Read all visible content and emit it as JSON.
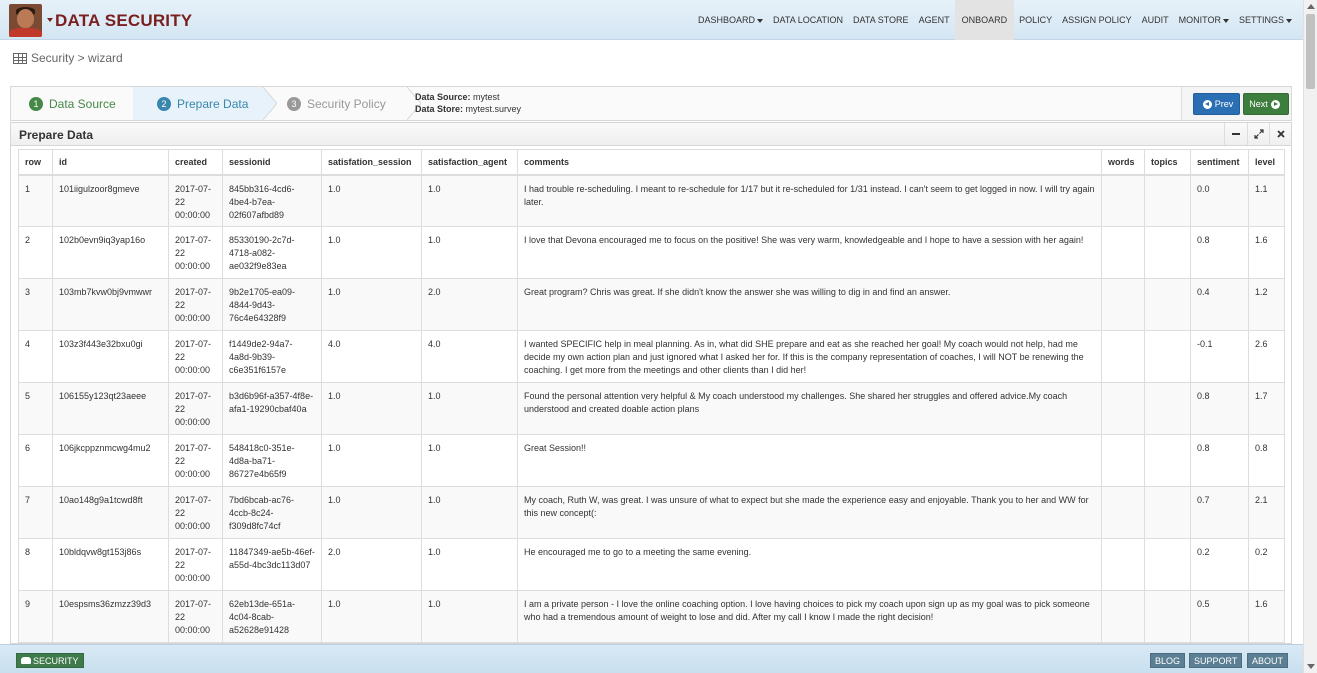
{
  "brand": {
    "title": "DATA SECURITY"
  },
  "nav": {
    "items": [
      {
        "label": "DASHBOARD",
        "dropdown": true
      },
      {
        "label": "DATA LOCATION",
        "dropdown": false
      },
      {
        "label": "DATA STORE",
        "dropdown": false
      },
      {
        "label": "AGENT",
        "dropdown": false
      },
      {
        "label": "ONBOARD",
        "dropdown": false,
        "active": true
      },
      {
        "label": "POLICY",
        "dropdown": false
      },
      {
        "label": "ASSIGN POLICY",
        "dropdown": false
      },
      {
        "label": "AUDIT",
        "dropdown": false
      },
      {
        "label": "MONITOR",
        "dropdown": true
      },
      {
        "label": "SETTINGS",
        "dropdown": true
      }
    ]
  },
  "breadcrumb": {
    "text": "Security > wizard"
  },
  "wizard": {
    "steps": [
      {
        "num": "1",
        "label": "Data Source"
      },
      {
        "num": "2",
        "label": "Prepare Data"
      },
      {
        "num": "3",
        "label": "Security Policy"
      }
    ],
    "source_label": "Data Source:",
    "source_value": "mytest",
    "store_label": "Data Store:",
    "store_value": "mytest.survey",
    "prev_label": "Prev",
    "next_label": "Next"
  },
  "panel": {
    "title": "Prepare Data"
  },
  "table": {
    "columns": [
      "row",
      "id",
      "created",
      "sessionid",
      "satisfation_session",
      "satisfaction_agent",
      "comments",
      "words",
      "topics",
      "sentiment",
      "level"
    ],
    "rows": [
      [
        "1",
        "101iigulzoor8gmeve",
        "2017-07-22 00:00:00",
        "845bb316-4cd6-4be4-b7ea-02f607afbd89",
        "1.0",
        "1.0",
        "I had trouble re-scheduling. I meant to re-schedule for 1/17 but it re-scheduled for 1/31 instead. I can't seem to get logged in now. I will try again later.",
        "",
        "",
        "0.0",
        "1.1"
      ],
      [
        "2",
        "102b0evn9iq3yap16o",
        "2017-07-22 00:00:00",
        "85330190-2c7d-4718-a082-ae032f9e83ea",
        "1.0",
        "1.0",
        "I love that Devona encouraged me to focus on the positive! She was very warm, knowledgeable and I hope to have a session with her again!",
        "",
        "",
        "0.8",
        "1.6"
      ],
      [
        "3",
        "103mb7kvw0bj9vmwwr",
        "2017-07-22 00:00:00",
        "9b2e1705-ea09-4844-9d43-76c4e64328f9",
        "1.0",
        "2.0",
        "Great program? Chris was great. If she didn't know the answer she was willing to dig in and find an answer.",
        "",
        "",
        "0.4",
        "1.2"
      ],
      [
        "4",
        "103z3f443e32bxu0gi",
        "2017-07-22 00:00:00",
        "f1449de2-94a7-4a8d-9b39-c6e351f6157e",
        "4.0",
        "4.0",
        "I wanted SPECIFIC help in meal planning. As in, what did SHE prepare and eat as she reached her goal! My coach would not help, had me decide my own action plan and just ignored what I asked her for. If this is the company representation of coaches, I will NOT be renewing the coaching. I get more from the meetings and other clients than I did her!",
        "",
        "",
        "-0.1",
        "2.6"
      ],
      [
        "5",
        "106155y123qt23aeee",
        "2017-07-22 00:00:00",
        "b3d6b96f-a357-4f8e-afa1-19290cbaf40a",
        "1.0",
        "1.0",
        "Found the personal attention very helpful & My coach understood my challenges. She shared her struggles and offered advice.My coach understood and created doable action plans",
        "",
        "",
        "0.8",
        "1.7"
      ],
      [
        "6",
        "106jkcppznmcwg4mu2",
        "2017-07-22 00:00:00",
        "548418c0-351e-4d8a-ba71-86727e4b65f9",
        "1.0",
        "1.0",
        "Great Session!!",
        "",
        "",
        "0.8",
        "0.8"
      ],
      [
        "7",
        "10ao148g9a1tcwd8ft",
        "2017-07-22 00:00:00",
        "7bd6bcab-ac76-4ccb-8c24-f309d8fc74cf",
        "1.0",
        "1.0",
        "My coach, Ruth W, was great. I was unsure of what to expect but she made the experience easy and enjoyable. Thank you to her and WW for this new concept(:",
        "",
        "",
        "0.7",
        "2.1"
      ],
      [
        "8",
        "10bldqvw8gt153j86s",
        "2017-07-22 00:00:00",
        "11847349-ae5b-46ef-a55d-4bc3dc113d07",
        "2.0",
        "1.0",
        "He encouraged me to go to a meeting the same evening.",
        "",
        "",
        "0.2",
        "0.2"
      ],
      [
        "9",
        "10espsms36zmzz39d3",
        "2017-07-22 00:00:00",
        "62eb13de-651a-4c04-8cab-a52628e91428",
        "1.0",
        "1.0",
        "I am a private person - I love the online coaching option. I love having choices to pick my coach upon sign up as my goal was to pick someone who had a tremendous amount of weight to lose and did. After my call I know I made the right decision!",
        "",
        "",
        "0.5",
        "1.6"
      ]
    ]
  },
  "footer": {
    "security_label": "SECURITY",
    "links": [
      "BLOG",
      "SUPPORT",
      "ABOUT"
    ]
  }
}
